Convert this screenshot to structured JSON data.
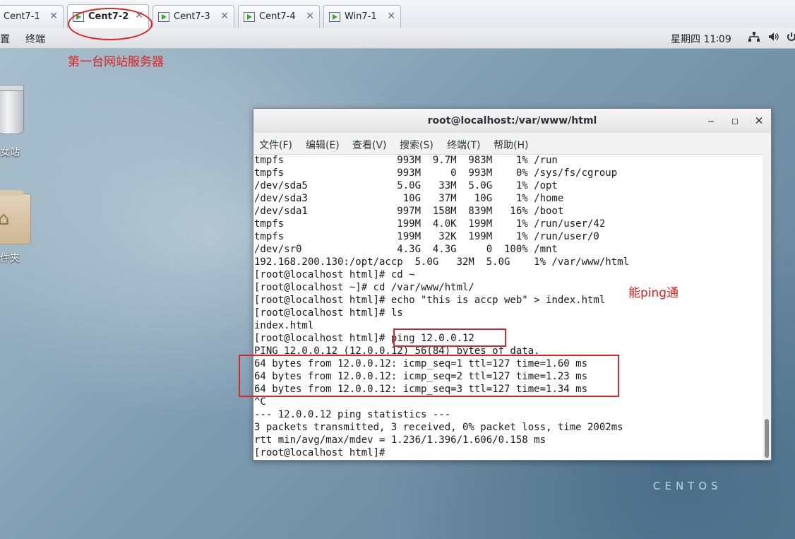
{
  "vm_tabs": [
    {
      "label": "Cent7-1",
      "active": false
    },
    {
      "label": "Cent7-2",
      "active": true
    },
    {
      "label": "Cent7-3",
      "active": false
    },
    {
      "label": "Cent7-4",
      "active": false
    },
    {
      "label": "Win7-1",
      "active": false
    }
  ],
  "panel": {
    "menu_applications_partial": "置",
    "menu_terminal": "终端",
    "clock": "星期四 11∶09"
  },
  "annotations": {
    "server_note": "第一台网站服务器",
    "ping_note": "能ping通",
    "color": "#e0201e"
  },
  "desktop": {
    "trash_label_partial": "女站",
    "folder_label_partial": "件夹",
    "watermark": "CENTOS"
  },
  "terminal": {
    "title": "root@localhost:/var/www/html",
    "menus": [
      "文件(F)",
      "编辑(E)",
      "查看(V)",
      "搜索(S)",
      "终端(T)",
      "帮助(H)"
    ],
    "lines": [
      "tmpfs                   993M  9.7M  983M    1% /run",
      "tmpfs                   993M     0  993M    0% /sys/fs/cgroup",
      "/dev/sda5               5.0G   33M  5.0G    1% /opt",
      "/dev/sda3                10G   37M   10G    1% /home",
      "/dev/sda1               997M  158M  839M   16% /boot",
      "tmpfs                   199M  4.0K  199M    1% /run/user/42",
      "tmpfs                   199M   32K  199M    1% /run/user/0",
      "/dev/sr0                4.3G  4.3G     0  100% /mnt",
      "192.168.200.130:/opt/accp  5.0G   32M  5.0G    1% /var/www/html",
      "[root@localhost html]# cd ~",
      "[root@localhost ~]# cd /var/www/html/",
      "[root@localhost html]# echo \"this is accp web\" > index.html",
      "[root@localhost html]# ls",
      "index.html",
      "[root@localhost html]# ping 12.0.0.12",
      "PING 12.0.0.12 (12.0.0.12) 56(84) bytes of data.",
      "64 bytes from 12.0.0.12: icmp_seq=1 ttl=127 time=1.60 ms",
      "64 bytes from 12.0.0.12: icmp_seq=2 ttl=127 time=1.23 ms",
      "64 bytes from 12.0.0.12: icmp_seq=3 ttl=127 time=1.34 ms",
      "^C",
      "--- 12.0.0.12 ping statistics ---",
      "3 packets transmitted, 3 received, 0% packet loss, time 2002ms",
      "rtt min/avg/max/mdev = 1.236/1.396/1.606/0.158 ms",
      "[root@localhost html]# "
    ]
  }
}
